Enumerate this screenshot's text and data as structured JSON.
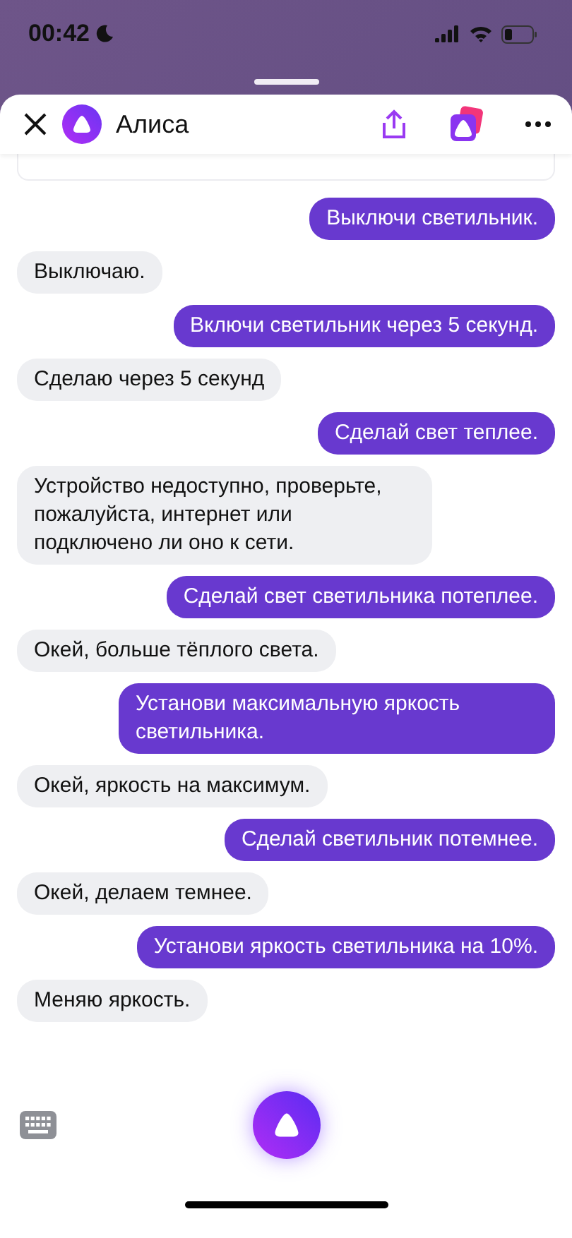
{
  "status_bar": {
    "time": "00:42"
  },
  "header": {
    "title": "Алиса"
  },
  "messages": [
    {
      "kind": "user",
      "text": "Выключи светильник."
    },
    {
      "kind": "bot",
      "text": "Выключаю."
    },
    {
      "kind": "user",
      "text": "Включи светильник через 5 секунд."
    },
    {
      "kind": "bot",
      "text": "Сделаю через 5 секунд"
    },
    {
      "kind": "user",
      "text": "Сделай свет теплее."
    },
    {
      "kind": "bot",
      "text": "Устройство недоступно, проверьте, пожалуйста, интернет или подключено ли оно к сети."
    },
    {
      "kind": "user",
      "text": "Сделай свет светильника потеплее."
    },
    {
      "kind": "bot",
      "text": "Окей, больше тёплого света."
    },
    {
      "kind": "user",
      "text": "Установи максимальную яркость светильника."
    },
    {
      "kind": "bot",
      "text": "Окей, яркость на максимум."
    },
    {
      "kind": "user",
      "text": "Сделай светильник потемнее."
    },
    {
      "kind": "bot",
      "text": "Окей, делаем темнее."
    },
    {
      "kind": "user",
      "text": "Установи яркость светильника на 10%."
    },
    {
      "kind": "bot",
      "text": "Меняю яркость."
    }
  ]
}
